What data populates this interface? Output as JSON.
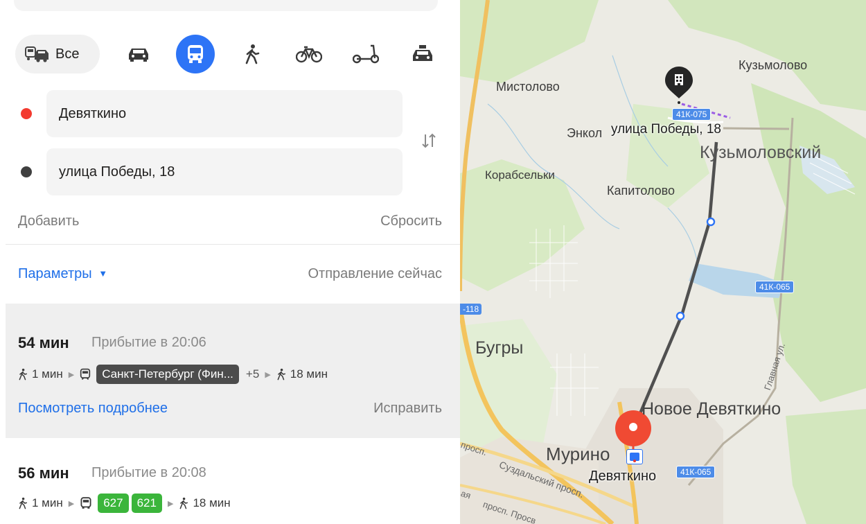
{
  "modes": {
    "all_label": "Все",
    "items": [
      "car-icon",
      "bus-icon",
      "pedestrian-icon",
      "bicycle-icon",
      "scooter-icon",
      "taxi-icon"
    ],
    "active": "bus-icon",
    "active_color": "#2d74f6"
  },
  "route": {
    "from": "Девяткино",
    "to": "улица Победы, 18",
    "from_color": "#f33a2f",
    "to_color": "#404040",
    "add_label": "Добавить",
    "reset_label": "Сбросить"
  },
  "params": {
    "label": "Параметры",
    "departure": "Отправление сейчас"
  },
  "routes": [
    {
      "duration": "54 мин",
      "arrival": "Прибытие в 20:06",
      "walk_start": "1 мин",
      "transport": "Санкт-Петербург (Фин...",
      "extra": "+5",
      "walk_end": "18 мин",
      "details_label": "Посмотреть подробнее",
      "fix_label": "Исправить"
    },
    {
      "duration": "56 мин",
      "arrival": "Прибытие в 20:08",
      "walk_start": "1 мин",
      "buses": [
        "627",
        "621"
      ],
      "walk_end": "18 мин"
    }
  ],
  "map": {
    "places": {
      "kuzmolovo": "Кузьмолово",
      "mistolovo": "Мистолово",
      "enkol": "Энкол",
      "destination": "улица Победы, 18",
      "kuzmolovsky": "Кузьмоловский",
      "korabselki": "Корабсельки",
      "kapitolovo": "Капитолово",
      "bugry": "Бугры",
      "novoe_devyatkino": "Новое Девяткино",
      "murino": "Мурино",
      "devyatkino": "Девяткино",
      "suzdalsky": "Суздальский просп.",
      "prosp_1": "просп.",
      "prosp_2": "просп. Просв",
      "prosp_3": "ая",
      "glavnaya": "Главная ул."
    },
    "road_badges": {
      "r41k075": "41К-075",
      "r41k065a": "41К-065",
      "r41k065b": "41К-065",
      "r118": "-118"
    }
  }
}
